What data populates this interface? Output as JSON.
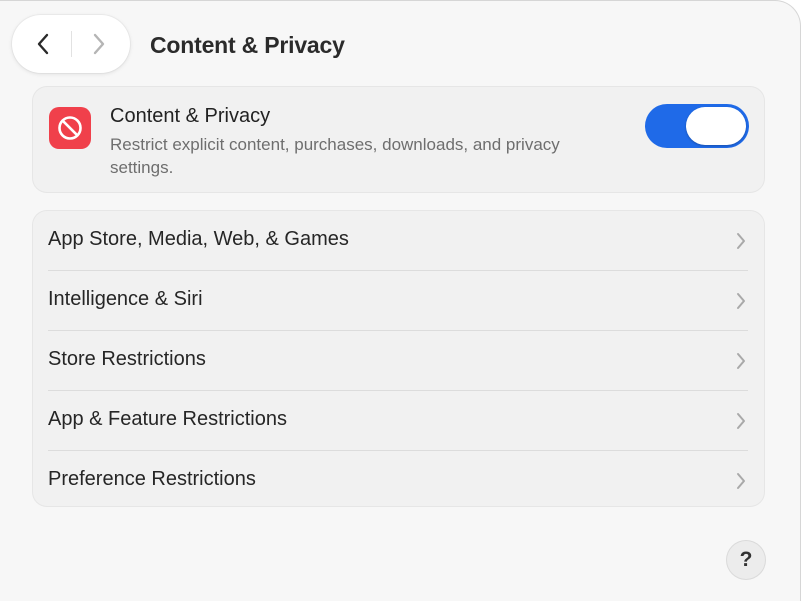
{
  "header": {
    "title": "Content & Privacy",
    "back_icon": "chevron-left-icon",
    "forward_icon": "chevron-right-icon"
  },
  "content_privacy": {
    "icon": "prohibited-icon",
    "icon_color": "#f0404b",
    "title": "Content & Privacy",
    "description": "Restrict explicit content, purchases, downloads, and privacy settings.",
    "toggle_on": true,
    "toggle_color": "#1f6ae8"
  },
  "settings_list": {
    "items": [
      {
        "label": "App Store, Media, Web, & Games"
      },
      {
        "label": "Intelligence & Siri"
      },
      {
        "label": "Store Restrictions"
      },
      {
        "label": "App & Feature Restrictions"
      },
      {
        "label": "Preference Restrictions"
      }
    ]
  },
  "help": {
    "label": "?"
  }
}
